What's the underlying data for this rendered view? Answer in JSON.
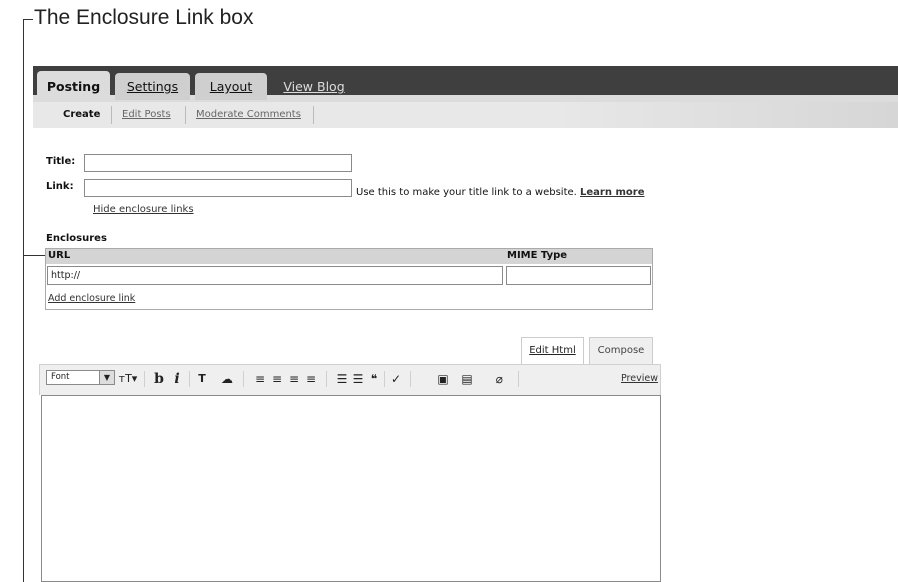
{
  "callout": {
    "label": "The Enclosure Link box"
  },
  "tabs": [
    {
      "label": "Posting",
      "state": "active"
    },
    {
      "label": "Settings",
      "state": "inactive"
    },
    {
      "label": "Layout",
      "state": "inactive"
    },
    {
      "label": "View Blog",
      "state": "link"
    }
  ],
  "subtabs": [
    {
      "label": "Create",
      "selected": true
    },
    {
      "label": "Edit Posts",
      "selected": false
    },
    {
      "label": "Moderate Comments",
      "selected": false
    }
  ],
  "form": {
    "title_label": "Title:",
    "title_value": "",
    "link_label": "Link:",
    "link_value": "",
    "link_hint": "Use this to make your title link to a website.",
    "learn_more": "Learn more",
    "hide_enclosure": "Hide enclosure links"
  },
  "enclosures": {
    "heading": "Enclosures",
    "col_url": "URL",
    "col_mime": "MIME Type",
    "url_value": "http://",
    "mime_value": "",
    "add_link": "Add enclosure link"
  },
  "editor": {
    "tab_edit_html": "Edit Html",
    "tab_compose": "Compose",
    "font_select": "Font",
    "preview": "Preview",
    "toolbar_icons": [
      "font-size-icon",
      "bold-icon",
      "italic-icon",
      "text-color-icon",
      "link-icon",
      "align-left-icon",
      "align-center-icon",
      "align-right-icon",
      "justify-icon",
      "numbered-list-icon",
      "bulleted-list-icon",
      "blockquote-icon",
      "spellcheck-icon",
      "image-icon",
      "video-icon",
      "clear-formatting-icon"
    ],
    "glyphs": {
      "font_size": "тT▾",
      "bold": "b",
      "italic": "i",
      "text_color": "T",
      "link": "☁",
      "align": "≡",
      "list": "☰",
      "quote": "❝",
      "spell": "✓",
      "image": "▣",
      "video": "▤",
      "erase": "⌀"
    }
  },
  "colors": {
    "tabbar": "#3f3f3f",
    "tab_active": "#dcdcdc",
    "link": "#333333"
  }
}
